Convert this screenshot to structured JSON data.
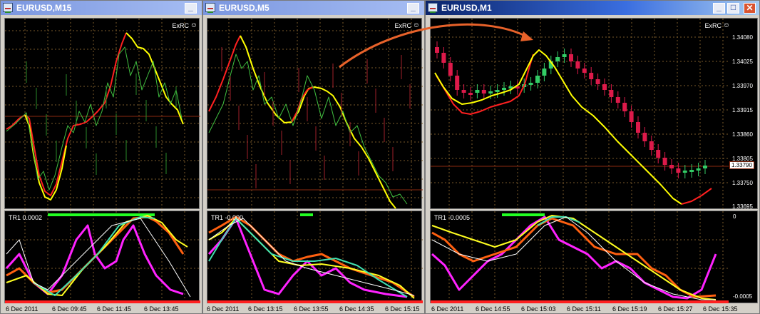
{
  "windows": [
    {
      "title": "EURUSD,M15",
      "active": false,
      "expert_label": "ExRC",
      "indicator_label": "TR1 0.0002",
      "time_labels": [
        "6 Dec 2011",
        "6 Dec 09:45",
        "6 Dec 11:45",
        "6 Dec 13:45"
      ]
    },
    {
      "title": "EURUSD,M5",
      "active": false,
      "expert_label": "ExRC",
      "indicator_label": "TR1 -0.000",
      "time_labels": [
        "6 Dec 2011",
        "6 Dec 13:15",
        "6 Dec 13:55",
        "6 Dec 14:35",
        "6 Dec 15:15"
      ]
    },
    {
      "title": "EURUSD,M1",
      "active": true,
      "expert_label": "ExRC",
      "indicator_label": "TR1 -0.0005",
      "price_labels": [
        "1.34080",
        "1.34025",
        "1.33970",
        "1.33915",
        "1.33860",
        "1.33805",
        "1.33750",
        "1.33695"
      ],
      "current_price": "1.33790",
      "indicator_scale": [
        "0",
        "-0.0005"
      ],
      "time_labels": [
        "6 Dec 2011",
        "6 Dec 14:55",
        "6 Dec 15:03",
        "6 Dec 15:11",
        "6 Dec 15:19",
        "6 Dec 15:27",
        "6 Dec 15:35"
      ]
    }
  ],
  "colors": {
    "background": "#000000",
    "grid": "#7a5a2a",
    "ma_rising": "#ff2020",
    "ma_falling": "#ffff00",
    "candle_up": "#33cc66",
    "candle_down": "#dd1a4a",
    "price_line": "#8b2a10",
    "annotation_arrow": "#e8622a",
    "osc_magenta": "#ff22ff",
    "osc_orange": "#ff6010",
    "osc_yellow": "#ffff20",
    "osc_cyan": "#40e0b0",
    "signal_green": "#22ff22",
    "signal_red": "#ff2020"
  }
}
